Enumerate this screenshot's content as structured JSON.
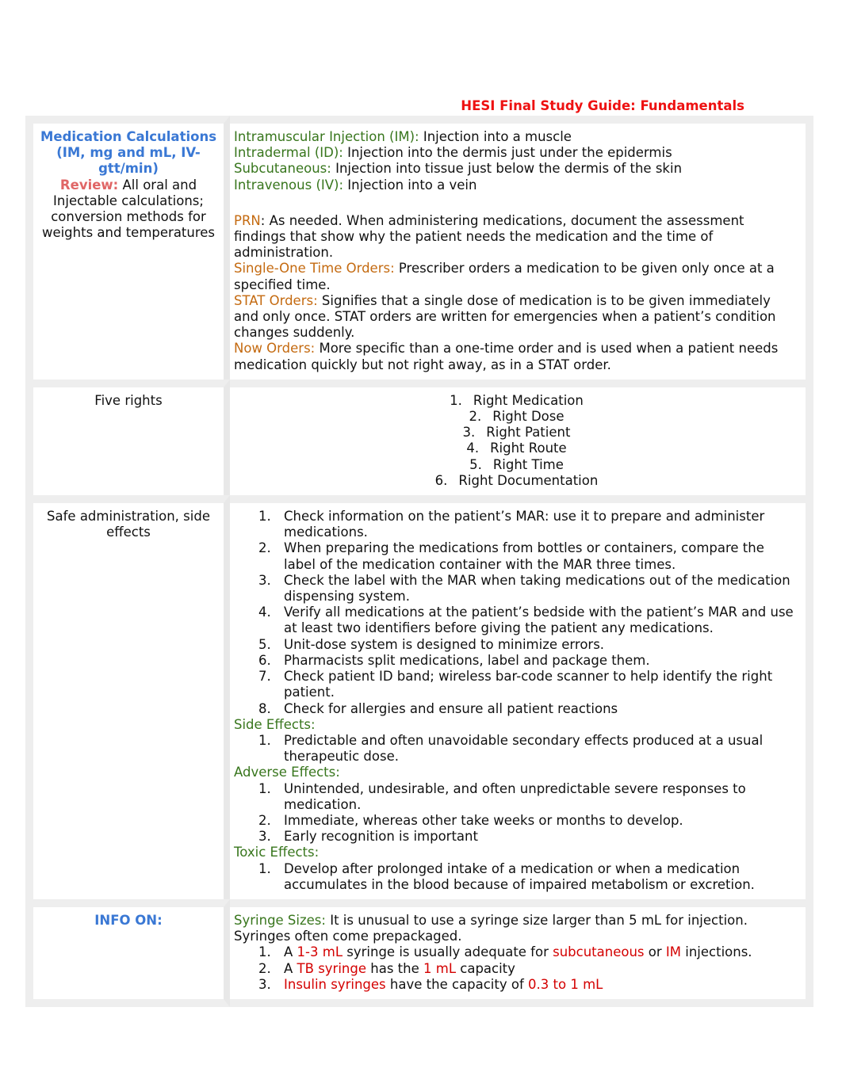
{
  "document": {
    "title": "HESI Final Study Guide: Fundamentals"
  },
  "rows": {
    "med_calc": {
      "left": {
        "heading": "Medication Calculations (IM, mg and mL, IV-gtt/min)",
        "review_label": "Review:",
        "review_text": " All oral and Injectable calculations; conversion methods for weights and temperatures"
      },
      "routes": [
        {
          "term": "Intramuscular Injection (IM):",
          "definition": " Injection into a muscle"
        },
        {
          "term": "Intradermal (ID):",
          "definition": " Injection into the dermis just under the epidermis"
        },
        {
          "term": "Subcutaneous:",
          "definition": " Injection into tissue just below the dermis of the skin"
        },
        {
          "term": "Intravenous (IV):",
          "definition": " Injection into a vein"
        }
      ],
      "orders": [
        {
          "term": "PRN",
          "definition": ": As needed. When administering medications, document the assessment findings that show why the patient needs the medication and the time of administration."
        },
        {
          "term": "Single-One Time Orders:",
          "definition": " Prescriber orders a medication to be given only once at a specified time."
        },
        {
          "term": "STAT Orders:",
          "definition": " Signifies that a single dose of medication is to be given immediately and only once. STAT orders are written for emergencies when a patient’s condition changes suddenly."
        },
        {
          "term": "Now Orders:",
          "definition": " More specific than a one-time order and is used when a patient needs medication quickly but not right away, as in a STAT order."
        }
      ]
    },
    "five_rights": {
      "left": "Five rights",
      "items": [
        {
          "num": "1.",
          "text": "Right Medication"
        },
        {
          "num": "2.",
          "text": "Right Dose"
        },
        {
          "num": "3.",
          "text": "Right Patient"
        },
        {
          "num": "4.",
          "text": "Right Route"
        },
        {
          "num": "5.",
          "text": "Right Time"
        },
        {
          "num": "6.",
          "text": "Right Documentation"
        }
      ]
    },
    "safe_admin": {
      "left": "Safe administration, side effects",
      "steps": [
        {
          "num": "1.",
          "text": "Check information on the patient’s MAR: use it to prepare and administer medications."
        },
        {
          "num": "2.",
          "text": "When preparing the medications from bottles or containers, compare the label of the medication container with the MAR three times."
        },
        {
          "num": "3.",
          "text": "Check the label with the MAR when taking medications out of the medication dispensing system."
        },
        {
          "num": "4.",
          "text": "Verify all medications at the patient’s bedside with the patient’s MAR and use at least two identifiers before giving the patient any medications."
        },
        {
          "num": "5.",
          "text": "Unit-dose system is designed to minimize errors."
        },
        {
          "num": "6.",
          "text": "Pharmacists split medications, label and package them."
        },
        {
          "num": "7.",
          "text": "Check patient ID band; wireless bar-code scanner to help identify the right patient."
        },
        {
          "num": "8.",
          "text": "Check for allergies and ensure all patient reactions"
        }
      ],
      "side_effects": {
        "heading": "Side Effects:",
        "items": [
          {
            "num": "1.",
            "text": "Predictable and often unavoidable secondary effects produced at a usual therapeutic dose."
          }
        ]
      },
      "adverse_effects": {
        "heading": "Adverse Effects:",
        "items": [
          {
            "num": "1.",
            "text": "Unintended, undesirable, and often unpredictable severe responses to medication."
          },
          {
            "num": "2.",
            "text": "Immediate, whereas other take weeks or months to develop."
          },
          {
            "num": "3.",
            "text": "Early recognition is important"
          }
        ]
      },
      "toxic_effects": {
        "heading": "Toxic Effects:",
        "items": [
          {
            "num": "1.",
            "text": "Develop after prolonged intake of a medication or when a medication accumulates in the blood because of impaired metabolism or excretion."
          }
        ]
      }
    },
    "info_on": {
      "left": "INFO ON:",
      "syringe_term": "Syringe Sizes:",
      "syringe_text": " It is unusual to use a syringe size larger than 5 mL for injection. Syringes often come prepackaged.",
      "items": [
        {
          "num": "1.",
          "parts": [
            {
              "text": "A ",
              "hl": false
            },
            {
              "text": "1-3 mL",
              "hl": true
            },
            {
              "text": " syringe is usually adequate for ",
              "hl": false
            },
            {
              "text": "subcutaneous",
              "hl": true
            },
            {
              "text": " or ",
              "hl": false
            },
            {
              "text": "IM",
              "hl": true
            },
            {
              "text": " injections.",
              "hl": false
            }
          ]
        },
        {
          "num": "2.",
          "parts": [
            {
              "text": "A ",
              "hl": false
            },
            {
              "text": "TB syringe",
              "hl": true
            },
            {
              "text": " has the ",
              "hl": false
            },
            {
              "text": "1 mL",
              "hl": true
            },
            {
              "text": " capacity",
              "hl": false
            }
          ]
        },
        {
          "num": "3.",
          "parts": [
            {
              "text": "Insulin syringes",
              "hl": true
            },
            {
              "text": " have the capacity of ",
              "hl": false
            },
            {
              "text": "0.3 to 1 mL",
              "hl": true
            }
          ]
        }
      ]
    }
  },
  "colors": {
    "title_red": "#ee1111",
    "heading_blue": "#3a78d4",
    "review_red": "#e06666",
    "term_green": "#38761d",
    "term_orange": "#c46a10",
    "highlight_red": "#d40000"
  }
}
